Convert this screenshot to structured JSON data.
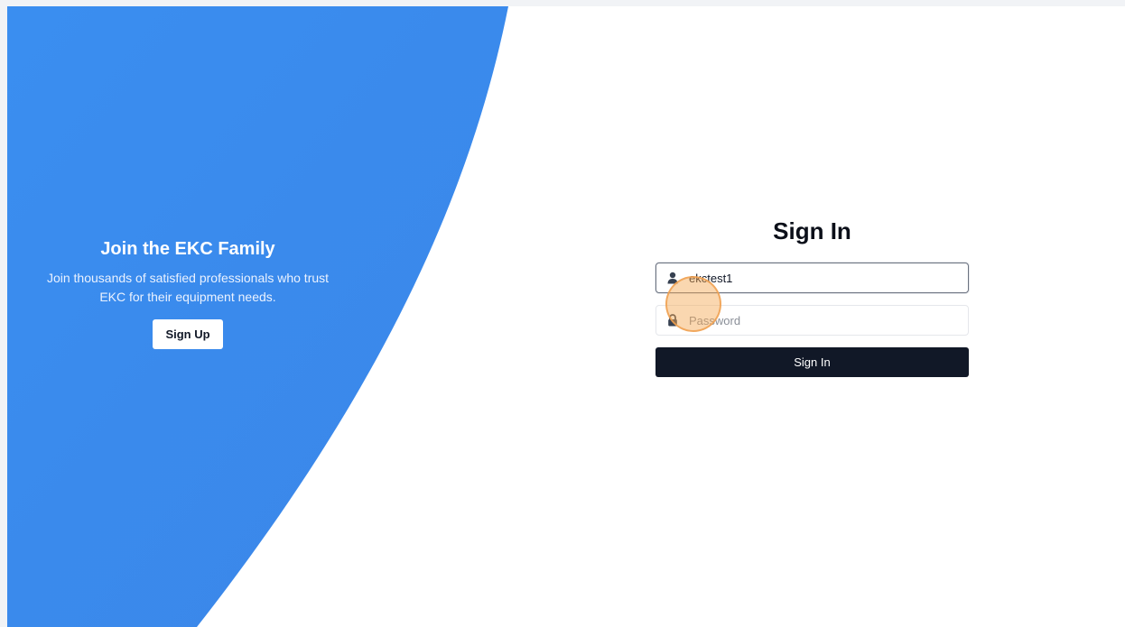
{
  "promo": {
    "title": "Join the EKC Family",
    "text": "Join thousands of satisfied professionals who trust EKC for their equipment needs.",
    "signup_label": "Sign Up"
  },
  "signin": {
    "title": "Sign In",
    "username_value": "ekctest1",
    "password_placeholder": "Password",
    "submit_label": "Sign In"
  },
  "icons": {
    "username": "user-icon",
    "password": "lock-icon"
  },
  "colors": {
    "brand_blue": "#3b8df0",
    "button_dark": "#111827",
    "cursor_highlight": "#f5a650"
  }
}
